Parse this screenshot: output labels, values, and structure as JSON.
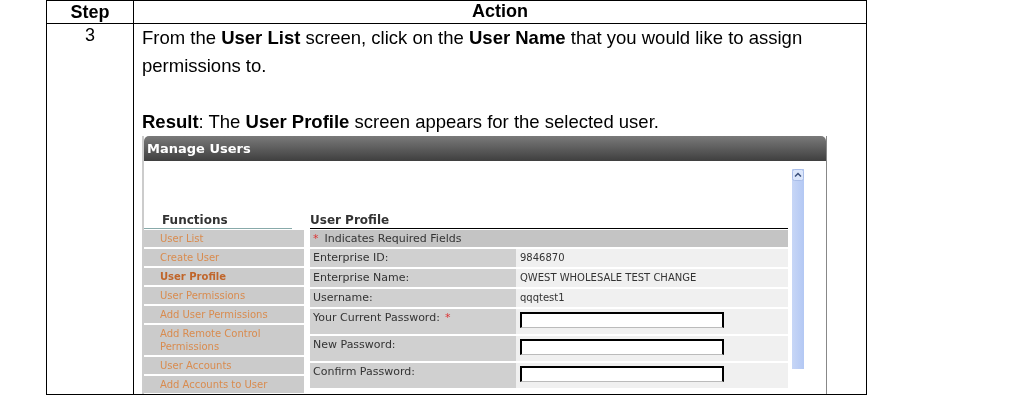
{
  "table": {
    "columns": [
      "Step",
      "Action"
    ],
    "rows": [
      {
        "step": "3",
        "instruction": "From the **User List** screen, click on the **User Name** that you would like to assign permissions to.",
        "result": "**Result**:  The **User Profile** screen appears for the selected user.",
        "screenshot": {
          "window": {
            "title": "Manage Users"
          },
          "sidebar": {
            "heading": "Functions",
            "items": [
              {
                "label": "User List",
                "selected": false
              },
              {
                "label": "Create User",
                "selected": false
              },
              {
                "label": "User Profile",
                "selected": true
              },
              {
                "label": "User Permissions",
                "selected": false
              },
              {
                "label": "Add User Permissions",
                "selected": false
              },
              {
                "label": "Add Remote Control Permissions",
                "selected": false
              },
              {
                "label": "User Accounts",
                "selected": false
              },
              {
                "label": "Add Accounts to User",
                "selected": false
              }
            ]
          },
          "profile": {
            "heading": "User Profile",
            "required_note": {
              "mark": "*",
              "text": "Indicates Required Fields"
            },
            "fields": [
              {
                "kind": "text",
                "label": "Enterprise ID:",
                "value": "9846870"
              },
              {
                "kind": "text",
                "label": "Enterprise Name:",
                "value": "QWEST WHOLESALE TEST CHANGE"
              },
              {
                "kind": "text",
                "label": "Username:",
                "value": "qqqtest1"
              },
              {
                "kind": "input",
                "label": "Your Current Password:",
                "required_mark": "*"
              },
              {
                "kind": "input",
                "label": "New Password:"
              },
              {
                "kind": "input",
                "label": "Confirm Password:"
              }
            ]
          }
        }
      }
    ]
  }
}
